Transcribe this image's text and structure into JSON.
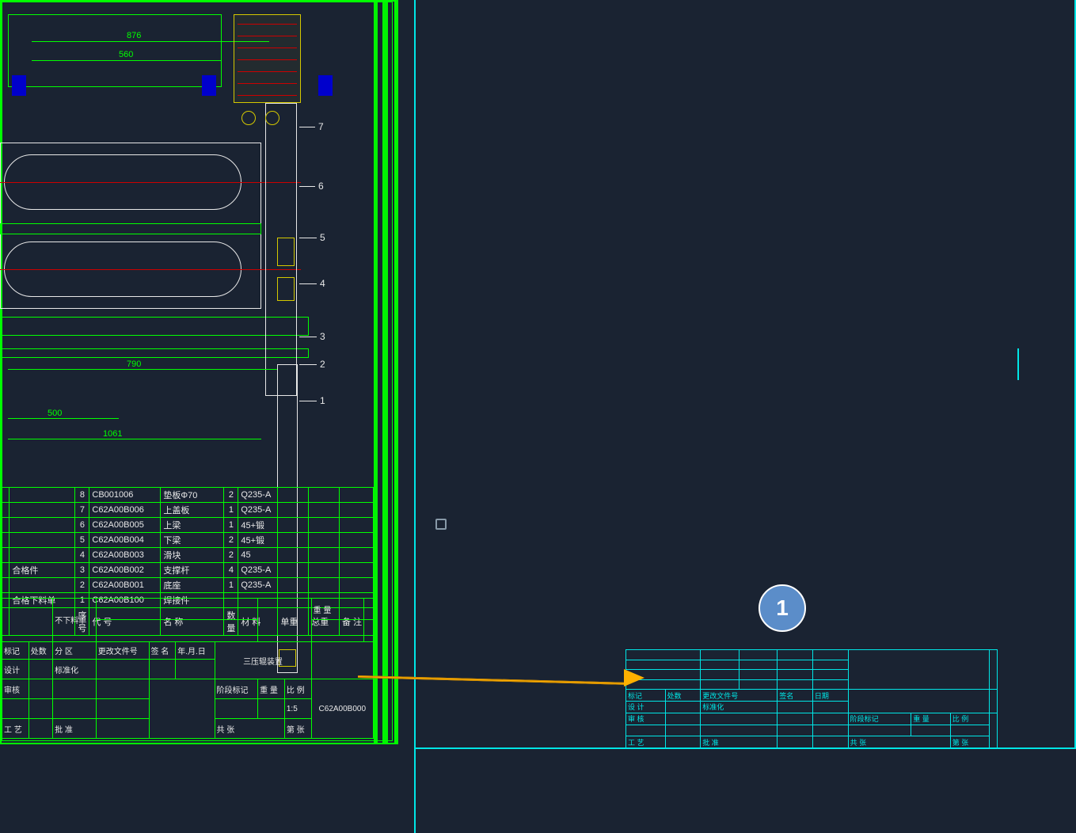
{
  "annotation": {
    "badge": "1"
  },
  "dimensions": {
    "d876": "876",
    "d560": "560",
    "d790": "790",
    "d500": "500",
    "d1061": "1061"
  },
  "callouts": [
    "1",
    "2",
    "3",
    "4",
    "5",
    "6",
    "7"
  ],
  "bom": {
    "rows": [
      {
        "idx": "8",
        "code": "CB001006",
        "desc": "垫板Φ70",
        "qty": "2",
        "mat": "Q235-A"
      },
      {
        "idx": "7",
        "code": "C62A00B006",
        "desc": "上盖板",
        "qty": "1",
        "mat": "Q235-A"
      },
      {
        "idx": "6",
        "code": "C62A00B005",
        "desc": "上梁",
        "qty": "1",
        "mat": "45+锻"
      },
      {
        "idx": "5",
        "code": "C62A00B004",
        "desc": "下梁",
        "qty": "2",
        "mat": "45+锻"
      },
      {
        "idx": "4",
        "code": "C62A00B003",
        "desc": "滑块",
        "qty": "2",
        "mat": "45"
      },
      {
        "idx": "3",
        "code": "C62A00B002",
        "desc": "支撑杆",
        "qty": "4",
        "mat": "Q235-A"
      },
      {
        "idx": "2",
        "code": "C62A00B001",
        "desc": "底座",
        "qty": "1",
        "mat": "Q235-A"
      },
      {
        "idx": "1",
        "code": "C62A00B100",
        "desc": "焊接件",
        "qty": "",
        "mat": ""
      }
    ],
    "left_labels": {
      "r3": "合格件",
      "r1": "合格下料单"
    }
  },
  "titleblock": {
    "hdr": {
      "c1": "序号",
      "c2": "代    号",
      "c3": "名    称",
      "c4": "数量",
      "c5": "材    料",
      "c6": "单重",
      "c7": "总重",
      "c8": "备 注",
      "c34": "重  量"
    },
    "left": {
      "a": "不下料单"
    },
    "row_mid": {
      "c1": "标记",
      "c2": "处数",
      "c3": "分 区",
      "c4": "更改文件号",
      "c5": "签 名",
      "c6": "年.月.日"
    },
    "rows": [
      {
        "c1": "设计",
        "c2": "",
        "c3": "标准化",
        "c4": ""
      },
      {
        "c1": "审核",
        "c2": "",
        "c3": "",
        "c4": ""
      },
      {
        "c1": "工 艺",
        "c2": "",
        "c3": "批 准",
        "c4": ""
      }
    ],
    "right": {
      "a": "阶段标记",
      "b": "重 量",
      "c": "比 例",
      "d": "共    张",
      "e": "第    张",
      "scale": "1:5"
    },
    "title": "三压辊装置",
    "drawing_no": "C62A00B000"
  },
  "right_tb": {
    "row_mid": {
      "c1": "标记",
      "c2": "处数",
      "c3": "更改文件号",
      "c4": "签名",
      "c5": "日期"
    },
    "rows": [
      {
        "c1": "设 计",
        "c3": "标准化"
      },
      {
        "c1": "审 核"
      },
      {
        "c1": "工 艺",
        "c3": "批 准"
      }
    ],
    "right": {
      "a": "阶段标记",
      "b": "重 量",
      "c": "比 例",
      "d": "共   张",
      "e": "第   张"
    }
  }
}
